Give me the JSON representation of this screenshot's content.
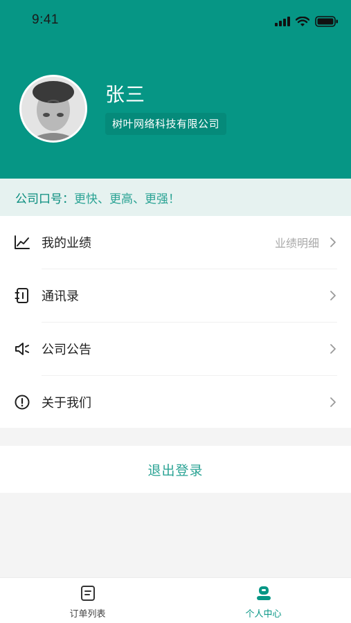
{
  "status_bar": {
    "time": "9:41"
  },
  "profile": {
    "name": "张三",
    "company": "树叶网络科技有限公司"
  },
  "slogan": {
    "label": "公司口号：",
    "text": "更快、更高、更强！"
  },
  "menu": {
    "items": [
      {
        "label": "我的业绩",
        "extra": "业绩明细",
        "icon": "chart-line-icon"
      },
      {
        "label": "通讯录",
        "extra": "",
        "icon": "contacts-book-icon"
      },
      {
        "label": "公司公告",
        "extra": "",
        "icon": "speaker-icon"
      },
      {
        "label": "关于我们",
        "extra": "",
        "icon": "info-circle-icon"
      }
    ]
  },
  "logout": {
    "label": "退出登录"
  },
  "tabbar": {
    "tabs": [
      {
        "label": "订单列表",
        "icon": "order-list-icon",
        "active": false
      },
      {
        "label": "个人中心",
        "icon": "profile-icon",
        "active": true
      }
    ]
  },
  "colors": {
    "primary": "#069685",
    "accent_text": "#2aa394",
    "slogan_bg": "#e6f2f0",
    "page_bg": "#f4f4f4",
    "inactive": "#555555"
  }
}
